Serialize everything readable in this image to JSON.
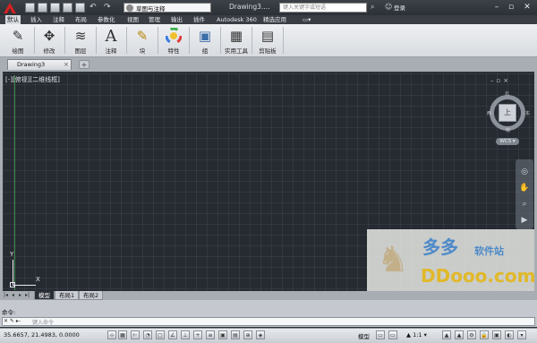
{
  "title_bar": {
    "app_menu_icon": "autocad-a-logo",
    "quick_access_icons": [
      "new-icon",
      "open-icon",
      "save-icon",
      "saveas-icon",
      "plot-icon",
      "undo-icon",
      "redo-icon"
    ],
    "workspace": "草图与注释",
    "document_title": "Drawing3....",
    "search_placeholder": "键入关键字或短语",
    "login_label": "登录",
    "window_buttons": [
      "minimize-icon",
      "restore-icon",
      "close-icon"
    ]
  },
  "ribbon_tabs": [
    "默认",
    "插入",
    "注释",
    "布局",
    "参数化",
    "视图",
    "管理",
    "输出",
    "插件",
    "Autodesk 360",
    "精选应用",
    "▭▾"
  ],
  "ribbon_panels": [
    {
      "label": "绘图",
      "icon": "draw-icon",
      "glyph": "✎"
    },
    {
      "label": "修改",
      "icon": "modify-icon",
      "glyph": "✥"
    },
    {
      "label": "图层",
      "icon": "layers-icon",
      "glyph": "≋"
    },
    {
      "label": "注释",
      "icon": "text-a-icon",
      "glyph": "A"
    },
    {
      "label": "块",
      "icon": "block-icon",
      "glyph": "✎"
    },
    {
      "label": "特性",
      "icon": "color-wheel-icon",
      "glyph": "◉"
    },
    {
      "label": "组",
      "icon": "group-icon",
      "glyph": "▣"
    },
    {
      "label": "实用工具",
      "icon": "calculator-icon",
      "glyph": "▦"
    },
    {
      "label": "剪贴板",
      "icon": "clipboard-icon",
      "glyph": "▤"
    }
  ],
  "doc_tabs": {
    "active": "Drawing3",
    "close": "×",
    "new_tab": "+"
  },
  "viewport": {
    "label": "[-][俯视][二维线框]",
    "ucs_x": "X",
    "ucs_y": "Y"
  },
  "viewcube": {
    "controls": "–▫×",
    "face": "上",
    "north": "北",
    "south": "南",
    "west": "西",
    "east": "东",
    "wcs": "WCS ▾"
  },
  "navbar_icons": [
    "orbit-icon",
    "pan-icon",
    "zoom-icon",
    "showmotion-icon"
  ],
  "layout_tabs": {
    "arrows": [
      "|◂",
      "◂",
      "▸",
      "▸|"
    ],
    "tabs": [
      "模型",
      "布局1",
      "布局2"
    ]
  },
  "command": {
    "history": "命令:",
    "controls": "✕ ✎ ▸-",
    "placeholder": "键入命令"
  },
  "status": {
    "coords": "35.6657, 21.4983, 0.0000",
    "model": "模型",
    "scale": "▲ 1:1 ▾",
    "tool_icons": [
      "snap-icon",
      "grid-icon",
      "ortho-icon",
      "polar-icon",
      "osnap-icon",
      "otrack-icon",
      "ducs-icon",
      "dyn-icon",
      "lweight-icon",
      "tpy-icon",
      "qp-icon",
      "sc-icon",
      "am-icon"
    ]
  },
  "watermark": {
    "cn": "多多",
    "cn_small": "软件站",
    "en": "DDooo.com"
  }
}
